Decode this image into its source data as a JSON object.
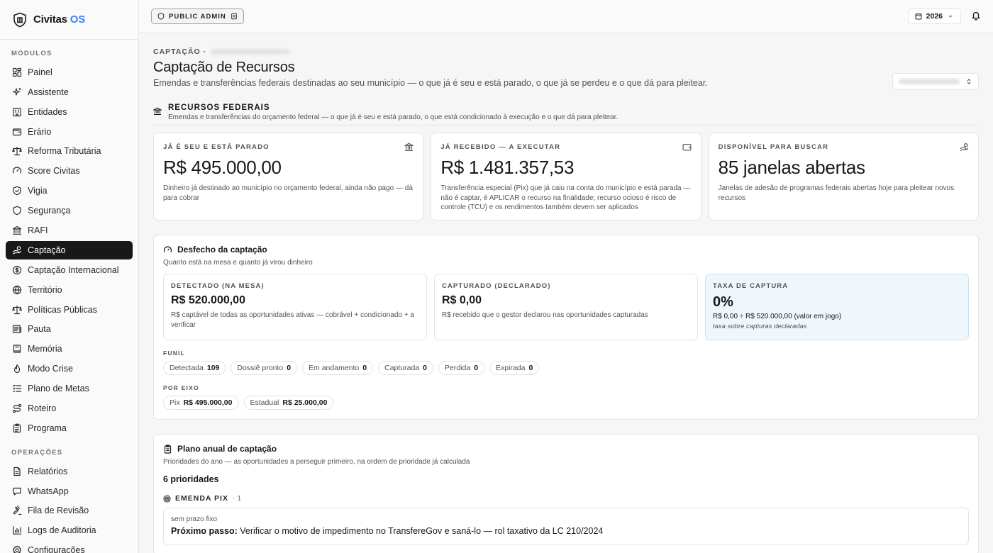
{
  "brand": {
    "name": "Civitas",
    "accent": "OS"
  },
  "sidebar": {
    "modules_label": "MÓDULOS",
    "modules": [
      {
        "label": "Painel",
        "icon": "grid-icon"
      },
      {
        "label": "Assistente",
        "icon": "sparkles-icon"
      },
      {
        "label": "Entidades",
        "icon": "building-icon"
      },
      {
        "label": "Erário",
        "icon": "wallet-icon"
      },
      {
        "label": "Reforma Tributária",
        "icon": "scale-icon"
      },
      {
        "label": "Score Civitas",
        "icon": "gauge-icon"
      },
      {
        "label": "Vigia",
        "icon": "shield-check-icon"
      },
      {
        "label": "Segurança",
        "icon": "shield-icon"
      },
      {
        "label": "RAFI",
        "icon": "landmark-icon"
      },
      {
        "label": "Captação",
        "icon": "handcoins-icon",
        "active": true
      },
      {
        "label": "Captação Internacional",
        "icon": "globe-dollar-icon"
      },
      {
        "label": "Território",
        "icon": "globe-icon"
      },
      {
        "label": "Políticas Públicas",
        "icon": "scale-icon"
      },
      {
        "label": "Pauta",
        "icon": "newspaper-icon"
      },
      {
        "label": "Memória",
        "icon": "book-icon"
      },
      {
        "label": "Modo Crise",
        "icon": "flame-icon"
      },
      {
        "label": "Plano de Metas",
        "icon": "list-checks-icon"
      },
      {
        "label": "Roteiro",
        "icon": "route-icon"
      },
      {
        "label": "Programa",
        "icon": "clipboard-icon"
      }
    ],
    "ops_label": "OPERAÇÕES",
    "ops": [
      {
        "label": "Relatórios",
        "icon": "file-icon"
      },
      {
        "label": "WhatsApp",
        "icon": "message-icon"
      },
      {
        "label": "Fila de Revisão",
        "icon": "gavel-icon"
      },
      {
        "label": "Logs de Auditoria",
        "icon": "chart-icon"
      },
      {
        "label": "Configurações",
        "icon": "settings-icon"
      }
    ]
  },
  "topbar": {
    "role": "PUBLIC ADMIN",
    "year": "2026"
  },
  "page": {
    "crumb": "CAPTAÇÃO ·",
    "title": "Captação de Recursos",
    "subtitle": "Emendas e transferências federais destinadas ao seu município — o que já é seu e está parado, o que já se perdeu e o que dá para pleitear."
  },
  "federal": {
    "title": "RECURSOS FEDERAIS",
    "subtitle": "Emendas e transferências do orçamento federal — o que já é seu e está parado, o que está condicionado à execução e o que dá para pleitear.",
    "kpis": [
      {
        "label": "JÁ É SEU E ESTÁ PARADO",
        "value": "R$ 495.000,00",
        "desc": "Dinheiro já destinado ao município no orçamento federal, ainda não pago — dá para cobrar",
        "icon": "landmark-icon"
      },
      {
        "label": "JÁ RECEBIDO — A EXECUTAR",
        "value": "R$ 1.481.357,53",
        "desc": "Transferência especial (Pix) que já caiu na conta do município e está parada — não é captar, é APLICAR o recurso na finalidade; recurso ocioso é risco de controle (TCU) e os rendimentos também devem ser aplicados",
        "icon": "wallet-icon"
      },
      {
        "label": "DISPONÍVEL PARA BUSCAR",
        "value": "85 janelas abertas",
        "desc": "Janelas de adesão de programas federais abertas hoje para pleitear novos recursos",
        "icon": "handcoins-icon"
      }
    ]
  },
  "outcome": {
    "title": "Desfecho da captação",
    "subtitle": "Quanto está na mesa e quanto já virou dinheiro",
    "metrics": [
      {
        "label": "DETECTADO (NA MESA)",
        "value": "R$ 520.000,00",
        "desc": "R$ captável de todas as oportunidades ativas — cobrável + condicionado + a verificar"
      },
      {
        "label": "CAPTURADO (DECLARADO)",
        "value": "R$ 0,00",
        "desc": "R$ recebido que o gestor declarou nas oportunidades capturadas"
      }
    ],
    "rate": {
      "label": "TAXA DE CAPTURA",
      "value": "0%",
      "formula": "R$ 0,00 ÷ R$ 520.000,00 (valor em jogo)",
      "note": "taxa sobre capturas declaradas"
    },
    "funnel_label": "FUNIL",
    "funnel": [
      {
        "label": "Detectada",
        "value": "109"
      },
      {
        "label": "Dossiê pronto",
        "value": "0"
      },
      {
        "label": "Em andamento",
        "value": "0"
      },
      {
        "label": "Capturada",
        "value": "0"
      },
      {
        "label": "Perdida",
        "value": "0"
      },
      {
        "label": "Expirada",
        "value": "0"
      }
    ],
    "axis_label": "POR EIXO",
    "axes": [
      {
        "label": "Pix",
        "value": "R$ 495.000,00"
      },
      {
        "label": "Estadual",
        "value": "R$ 25.000,00"
      }
    ]
  },
  "plan": {
    "title": "Plano anual de captação",
    "subtitle": "Prioridades do ano — as oportunidades a perseguir primeiro, na ordem de prioridade já calculada",
    "count": "6 prioridades",
    "group": {
      "label": "EMENDA PIX",
      "count": "· 1"
    },
    "task": {
      "deadline": "sem prazo fixo",
      "step_label": "Próximo passo:",
      "step": "Verificar o motivo de impedimento no TransfereGov e saná-lo — rol taxativo da LC 210/2024"
    }
  }
}
